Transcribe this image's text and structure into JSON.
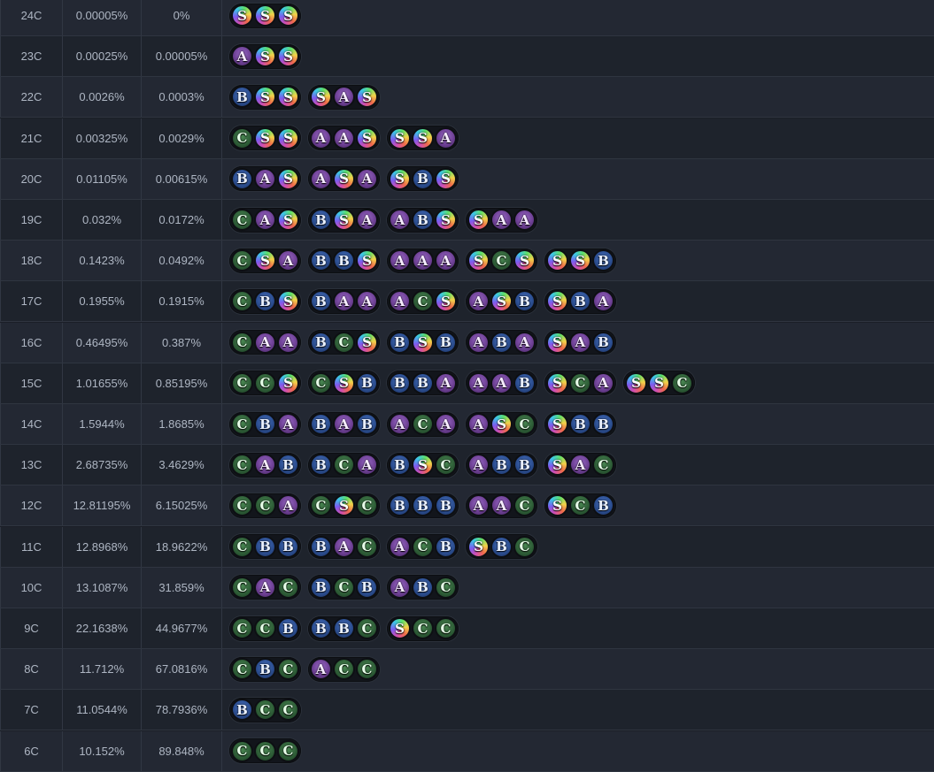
{
  "colors": {
    "background": "#1b1f27",
    "row_odd": "#232833",
    "row_even": "#1e232c",
    "text": "#aeb6c3",
    "tier_C": "#3d7a47",
    "tier_B": "#3a64b8",
    "tier_A": "#7e4fae",
    "tier_S": "rainbow"
  },
  "rows": [
    {
      "level": "24C",
      "p1": "0.00005%",
      "p2": "0%",
      "combos": [
        [
          "S",
          "S",
          "S"
        ]
      ]
    },
    {
      "level": "23C",
      "p1": "0.00025%",
      "p2": "0.00005%",
      "combos": [
        [
          "A",
          "S",
          "S"
        ]
      ]
    },
    {
      "level": "22C",
      "p1": "0.0026%",
      "p2": "0.0003%",
      "combos": [
        [
          "B",
          "S",
          "S"
        ],
        [
          "S",
          "A",
          "S"
        ]
      ]
    },
    {
      "level": "21C",
      "p1": "0.00325%",
      "p2": "0.0029%",
      "combos": [
        [
          "C",
          "S",
          "S"
        ],
        [
          "A",
          "A",
          "S"
        ],
        [
          "S",
          "S",
          "A"
        ]
      ]
    },
    {
      "level": "20C",
      "p1": "0.01105%",
      "p2": "0.00615%",
      "combos": [
        [
          "B",
          "A",
          "S"
        ],
        [
          "A",
          "S",
          "A"
        ],
        [
          "S",
          "B",
          "S"
        ]
      ]
    },
    {
      "level": "19C",
      "p1": "0.032%",
      "p2": "0.0172%",
      "combos": [
        [
          "C",
          "A",
          "S"
        ],
        [
          "B",
          "S",
          "A"
        ],
        [
          "A",
          "B",
          "S"
        ],
        [
          "S",
          "A",
          "A"
        ]
      ]
    },
    {
      "level": "18C",
      "p1": "0.1423%",
      "p2": "0.0492%",
      "combos": [
        [
          "C",
          "S",
          "A"
        ],
        [
          "B",
          "B",
          "S"
        ],
        [
          "A",
          "A",
          "A"
        ],
        [
          "S",
          "C",
          "S"
        ],
        [
          "S",
          "S",
          "B"
        ]
      ]
    },
    {
      "level": "17C",
      "p1": "0.1955%",
      "p2": "0.1915%",
      "combos": [
        [
          "C",
          "B",
          "S"
        ],
        [
          "B",
          "A",
          "A"
        ],
        [
          "A",
          "C",
          "S"
        ],
        [
          "A",
          "S",
          "B"
        ],
        [
          "S",
          "B",
          "A"
        ]
      ]
    },
    {
      "level": "16C",
      "p1": "0.46495%",
      "p2": "0.387%",
      "combos": [
        [
          "C",
          "A",
          "A"
        ],
        [
          "B",
          "C",
          "S"
        ],
        [
          "B",
          "S",
          "B"
        ],
        [
          "A",
          "B",
          "A"
        ],
        [
          "S",
          "A",
          "B"
        ]
      ]
    },
    {
      "level": "15C",
      "p1": "1.01655%",
      "p2": "0.85195%",
      "combos": [
        [
          "C",
          "C",
          "S"
        ],
        [
          "C",
          "S",
          "B"
        ],
        [
          "B",
          "B",
          "A"
        ],
        [
          "A",
          "A",
          "B"
        ],
        [
          "S",
          "C",
          "A"
        ],
        [
          "S",
          "S",
          "C"
        ]
      ]
    },
    {
      "level": "14C",
      "p1": "1.5944%",
      "p2": "1.8685%",
      "combos": [
        [
          "C",
          "B",
          "A"
        ],
        [
          "B",
          "A",
          "B"
        ],
        [
          "A",
          "C",
          "A"
        ],
        [
          "A",
          "S",
          "C"
        ],
        [
          "S",
          "B",
          "B"
        ]
      ]
    },
    {
      "level": "13C",
      "p1": "2.68735%",
      "p2": "3.4629%",
      "combos": [
        [
          "C",
          "A",
          "B"
        ],
        [
          "B",
          "C",
          "A"
        ],
        [
          "B",
          "S",
          "C"
        ],
        [
          "A",
          "B",
          "B"
        ],
        [
          "S",
          "A",
          "C"
        ]
      ]
    },
    {
      "level": "12C",
      "p1": "12.81195%",
      "p2": "6.15025%",
      "combos": [
        [
          "C",
          "C",
          "A"
        ],
        [
          "C",
          "S",
          "C"
        ],
        [
          "B",
          "B",
          "B"
        ],
        [
          "A",
          "A",
          "C"
        ],
        [
          "S",
          "C",
          "B"
        ]
      ]
    },
    {
      "level": "11C",
      "p1": "12.8968%",
      "p2": "18.9622%",
      "combos": [
        [
          "C",
          "B",
          "B"
        ],
        [
          "B",
          "A",
          "C"
        ],
        [
          "A",
          "C",
          "B"
        ],
        [
          "S",
          "B",
          "C"
        ]
      ]
    },
    {
      "level": "10C",
      "p1": "13.1087%",
      "p2": "31.859%",
      "combos": [
        [
          "C",
          "A",
          "C"
        ],
        [
          "B",
          "C",
          "B"
        ],
        [
          "A",
          "B",
          "C"
        ]
      ]
    },
    {
      "level": "9C",
      "p1": "22.1638%",
      "p2": "44.9677%",
      "combos": [
        [
          "C",
          "C",
          "B"
        ],
        [
          "B",
          "B",
          "C"
        ],
        [
          "S",
          "C",
          "C"
        ]
      ]
    },
    {
      "level": "8C",
      "p1": "11.712%",
      "p2": "67.0816%",
      "combos": [
        [
          "C",
          "B",
          "C"
        ],
        [
          "A",
          "C",
          "C"
        ]
      ]
    },
    {
      "level": "7C",
      "p1": "11.0544%",
      "p2": "78.7936%",
      "combos": [
        [
          "B",
          "C",
          "C"
        ]
      ]
    },
    {
      "level": "6C",
      "p1": "10.152%",
      "p2": "89.848%",
      "combos": [
        [
          "C",
          "C",
          "C"
        ]
      ]
    }
  ]
}
